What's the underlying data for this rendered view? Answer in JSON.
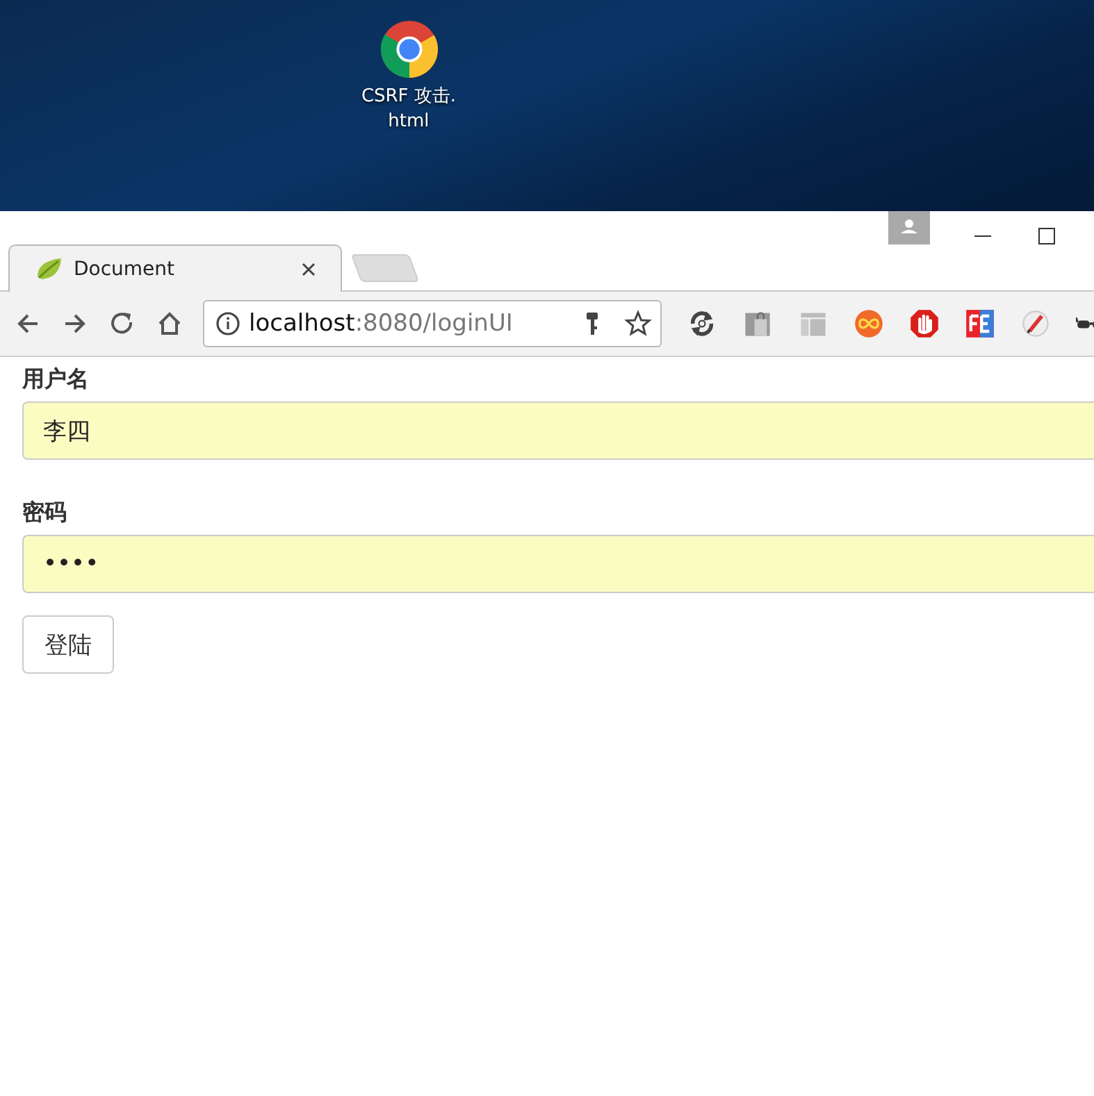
{
  "desktop": {
    "icons": [
      {
        "label": "CSRF 攻击.\nhtml"
      }
    ]
  },
  "browser": {
    "tabs": [
      {
        "title": "Document",
        "selected": true
      }
    ],
    "address": {
      "host": "localhost",
      "path": ":8080/loginUI"
    },
    "extensions": [
      {
        "kind": "sync"
      },
      {
        "kind": "bag"
      },
      {
        "kind": "layout"
      },
      {
        "kind": "infinity"
      },
      {
        "kind": "hand"
      },
      {
        "kind": "fe"
      },
      {
        "kind": "pen"
      },
      {
        "kind": "glasses"
      }
    ]
  },
  "form": {
    "fields": [
      {
        "label": "用户名",
        "value": "李四"
      },
      {
        "label": "密码",
        "value": "••••"
      }
    ],
    "button": "登陆"
  }
}
